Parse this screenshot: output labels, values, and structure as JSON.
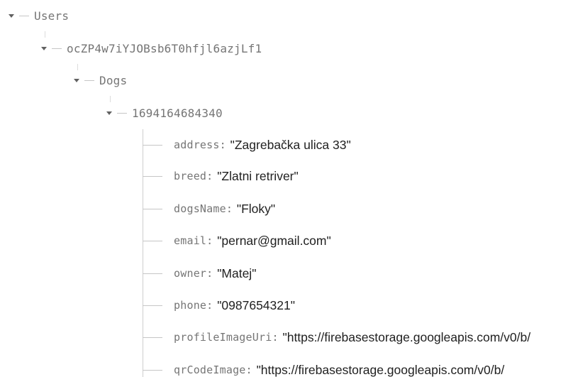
{
  "tree": {
    "root": {
      "key": "Users"
    },
    "user": {
      "key": "ocZP4w7iYJOBsb6T0hfjl6azjLf1"
    },
    "collection": {
      "key": "Dogs"
    },
    "document": {
      "key": "1694164684340"
    },
    "fields": [
      {
        "key": "address",
        "value": "\"Zagrebačka ulica 33\""
      },
      {
        "key": "breed",
        "value": "\"Zlatni retriver\""
      },
      {
        "key": "dogsName",
        "value": "\"Floky\""
      },
      {
        "key": "email",
        "value": "\"pernar@gmail.com\""
      },
      {
        "key": "owner",
        "value": "\"Matej\""
      },
      {
        "key": "phone",
        "value": "\"0987654321\""
      },
      {
        "key": "profileImageUri",
        "value": "\"https://firebasestorage.googleapis.com/v0/b/"
      },
      {
        "key": "qrCodeImage",
        "value": "\"https://firebasestorage.googleapis.com/v0/b/"
      }
    ],
    "colon": ":"
  },
  "colors": {
    "key_text": "#757575",
    "value_text": "#212121",
    "connector": "#cfcfcf",
    "caret": "#616161"
  }
}
